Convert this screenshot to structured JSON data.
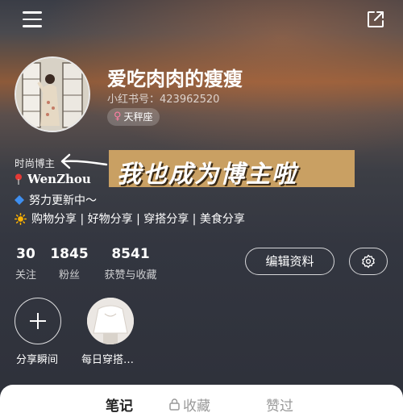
{
  "profile": {
    "nickname": "爱吃肉肉的瘦瘦",
    "red_id": "小红书号：423962520",
    "zodiac": "天秤座",
    "tag_label": "时尚博主",
    "banner_text": "我也成为博主啦"
  },
  "bio": {
    "line1": "WenZhou",
    "line2": "努力更新中～",
    "line3": "购物分享 | 好物分享 | 穿搭分享 | 美食分享"
  },
  "stats": [
    {
      "value": "30",
      "label": "关注"
    },
    {
      "value": "1845",
      "label": "粉丝"
    },
    {
      "value": "8541",
      "label": "获赞与收藏"
    }
  ],
  "actions": {
    "edit_label": "编辑资料"
  },
  "moments": [
    {
      "label": "分享瞬间"
    },
    {
      "label": "每日穿搭…"
    }
  ],
  "tabs": [
    {
      "label": "笔记"
    },
    {
      "label": "收藏"
    },
    {
      "label": "赞过"
    }
  ],
  "colors": {
    "banner": "#c9a063",
    "zodiac_symbol": "#ff7fa3"
  },
  "icons": [
    "menu-icon",
    "share-icon",
    "location-pin-icon",
    "blue-diamond-icon",
    "sun-icon",
    "gear-icon",
    "plus-icon",
    "lock-icon",
    "arrow-icon"
  ]
}
